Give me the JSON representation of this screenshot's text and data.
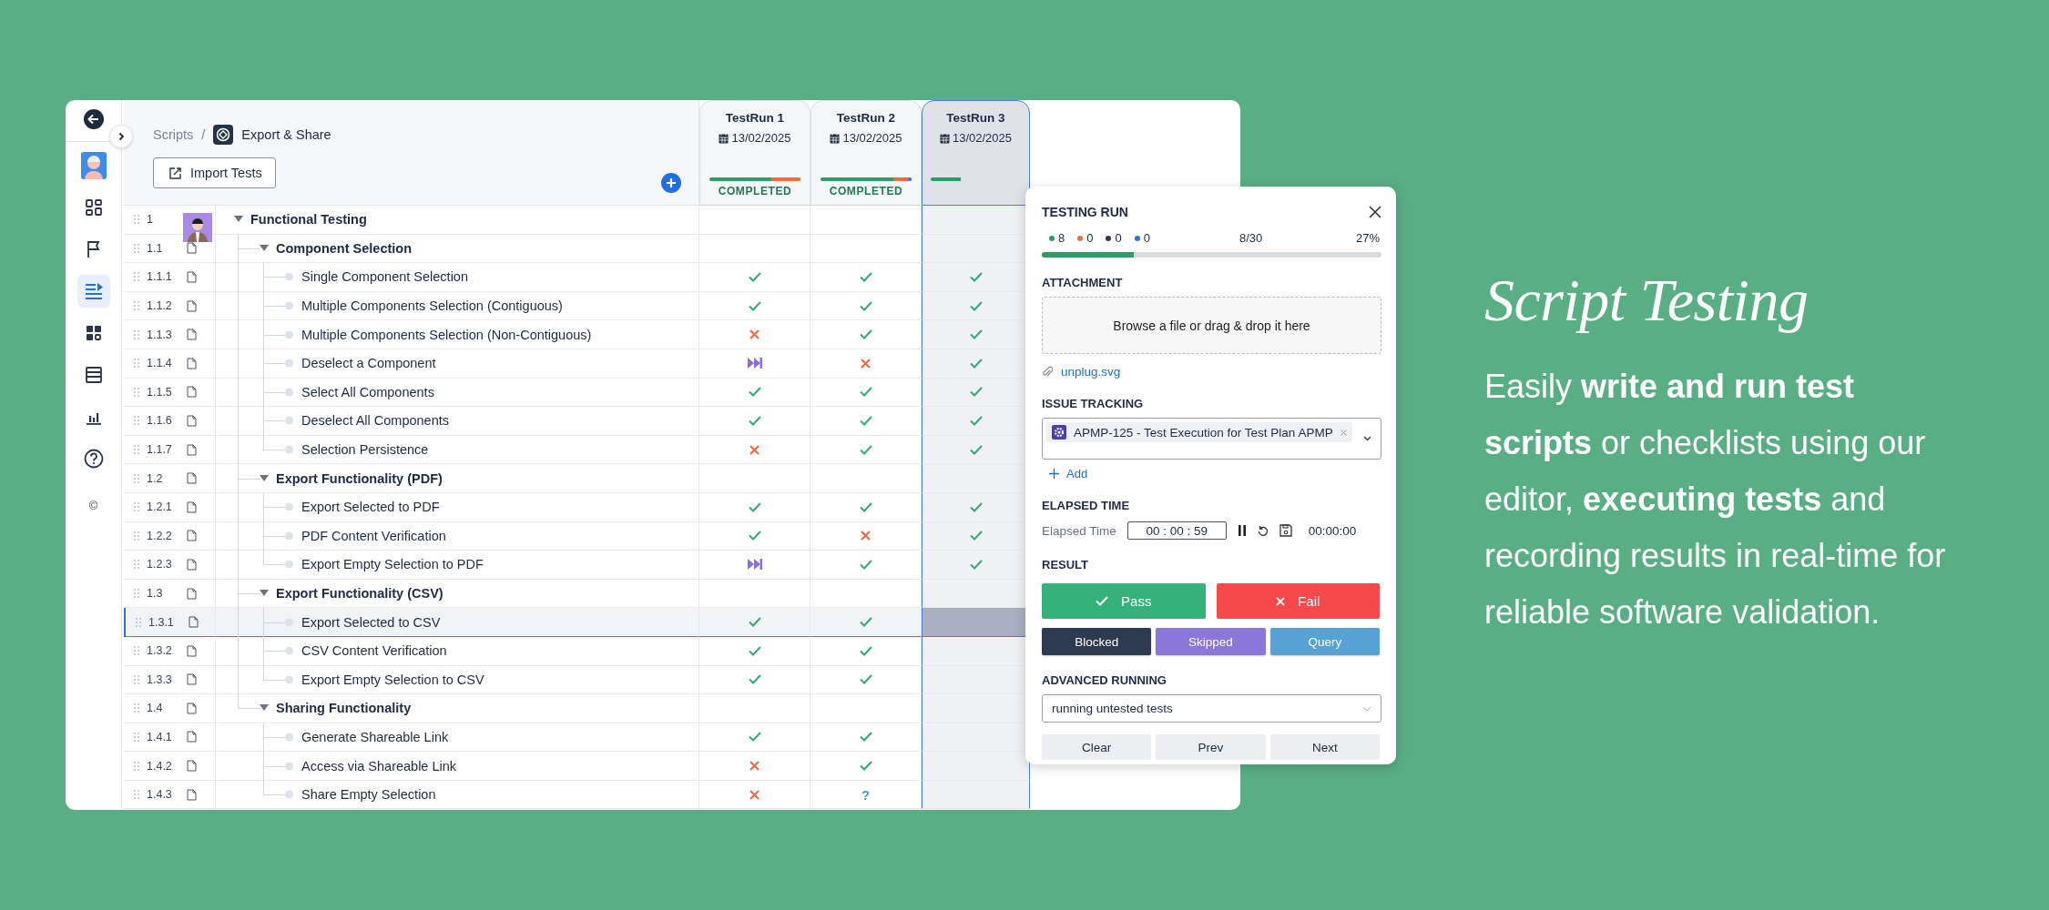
{
  "nav": {
    "items": [
      {
        "kind": "back",
        "selected": false
      },
      {
        "kind": "avatar",
        "selected": false
      },
      {
        "kind": "grid",
        "selected": false
      },
      {
        "kind": "flag",
        "selected": false
      },
      {
        "kind": "list",
        "selected": true
      },
      {
        "kind": "dashboard",
        "selected": false
      },
      {
        "kind": "table",
        "selected": false
      },
      {
        "kind": "chart",
        "selected": false
      },
      {
        "kind": "help",
        "selected": false
      }
    ],
    "footer_mark": "©"
  },
  "breadcrumb": {
    "parent": "Scripts",
    "separator": "/",
    "current": "Export & Share"
  },
  "import_button": "Import Tests",
  "runs": [
    {
      "name": "TestRun 1",
      "date": "13/02/2025",
      "status": "COMPLETED",
      "selected": false,
      "segments": [
        {
          "color": "#2e9b68",
          "level": 0.68
        },
        {
          "color": "#ef6a3c",
          "level": 0.32
        }
      ]
    },
    {
      "name": "TestRun 2",
      "date": "13/02/2025",
      "status": "COMPLETED",
      "selected": false,
      "segments": [
        {
          "color": "#2e9b68",
          "level": 0.8
        },
        {
          "color": "#ef6a3c",
          "level": 0.17
        },
        {
          "color": "#2f6fe0",
          "level": 0.03
        }
      ]
    },
    {
      "name": "TestRun 3",
      "date": "13/02/2025",
      "selected": true,
      "segments": [
        {
          "color": "#2e9b68",
          "level": 0.33
        }
      ]
    }
  ],
  "rows": [
    {
      "number": "1",
      "title": "Functional Testing",
      "kind": "group",
      "avatar": true,
      "selected": false,
      "children": [
        {
          "number": "1.1",
          "title": "Component Selection",
          "kind": "group",
          "selected": false,
          "children": [
            {
              "number": "1.1.1",
              "title": "Single Component Selection",
              "kind": "case",
              "selected": false,
              "results": [
                {
                  "kind": "pass"
                },
                {
                  "kind": "pass"
                },
                {
                  "kind": "pass"
                }
              ]
            },
            {
              "number": "1.1.2",
              "title": "Multiple Components Selection (Contiguous)",
              "kind": "case",
              "selected": false,
              "results": [
                {
                  "kind": "pass"
                },
                {
                  "kind": "pass"
                },
                {
                  "kind": "pass"
                }
              ]
            },
            {
              "number": "1.1.3",
              "title": "Multiple Components Selection (Non-Contiguous)",
              "kind": "case",
              "selected": false,
              "results": [
                {
                  "kind": "fail"
                },
                {
                  "kind": "pass"
                },
                {
                  "kind": "pass"
                }
              ]
            },
            {
              "number": "1.1.4",
              "title": "Deselect a Component",
              "kind": "case",
              "selected": false,
              "results": [
                {
                  "kind": "skipped"
                },
                {
                  "kind": "fail"
                },
                {
                  "kind": "pass"
                }
              ]
            },
            {
              "number": "1.1.5",
              "title": "Select All Components",
              "kind": "case",
              "selected": false,
              "results": [
                {
                  "kind": "pass"
                },
                {
                  "kind": "pass"
                },
                {
                  "kind": "pass"
                }
              ]
            },
            {
              "number": "1.1.6",
              "title": "Deselect All Components",
              "kind": "case",
              "selected": false,
              "results": [
                {
                  "kind": "pass"
                },
                {
                  "kind": "pass"
                },
                {
                  "kind": "pass"
                }
              ]
            },
            {
              "number": "1.1.7",
              "title": "Selection Persistence",
              "kind": "case",
              "selected": false,
              "results": [
                {
                  "kind": "fail"
                },
                {
                  "kind": "pass"
                },
                {
                  "kind": "pass"
                }
              ]
            }
          ]
        },
        {
          "number": "1.2",
          "title": "Export Functionality (PDF)",
          "kind": "group",
          "selected": false,
          "children": [
            {
              "number": "1.2.1",
              "title": "Export Selected to PDF",
              "kind": "case",
              "selected": false,
              "results": [
                {
                  "kind": "pass"
                },
                {
                  "kind": "pass"
                },
                {
                  "kind": "pass"
                }
              ]
            },
            {
              "number": "1.2.2",
              "title": "PDF Content Verification",
              "kind": "case",
              "selected": false,
              "results": [
                {
                  "kind": "pass"
                },
                {
                  "kind": "fail"
                },
                {
                  "kind": "pass"
                }
              ]
            },
            {
              "number": "1.2.3",
              "title": "Export Empty Selection to PDF",
              "kind": "case",
              "selected": false,
              "results": [
                {
                  "kind": "skipped"
                },
                {
                  "kind": "pass"
                },
                {
                  "kind": "pass"
                }
              ]
            }
          ]
        },
        {
          "number": "1.3",
          "title": "Export Functionality (CSV)",
          "kind": "group",
          "selected": false,
          "children": [
            {
              "number": "1.3.1",
              "title": "Export Selected to CSV",
              "kind": "case",
              "selected": true,
              "results": [
                {
                  "kind": "pass"
                },
                {
                  "kind": "pass"
                }
              ]
            },
            {
              "number": "1.3.2",
              "title": "CSV Content Verification",
              "kind": "case",
              "selected": false,
              "results": [
                {
                  "kind": "pass"
                },
                {
                  "kind": "pass"
                }
              ]
            },
            {
              "number": "1.3.3",
              "title": "Export Empty Selection to CSV",
              "kind": "case",
              "selected": false,
              "results": [
                {
                  "kind": "pass"
                },
                {
                  "kind": "pass"
                }
              ]
            }
          ]
        },
        {
          "number": "1.4",
          "title": "Sharing Functionality",
          "kind": "group",
          "selected": false,
          "children": [
            {
              "number": "1.4.1",
              "title": "Generate Shareable Link",
              "kind": "case",
              "selected": false,
              "results": [
                {
                  "kind": "pass"
                },
                {
                  "kind": "pass"
                }
              ]
            },
            {
              "number": "1.4.2",
              "title": "Access via Shareable Link",
              "kind": "case",
              "selected": false,
              "results": [
                {
                  "kind": "fail"
                },
                {
                  "kind": "pass"
                }
              ]
            },
            {
              "number": "1.4.3",
              "title": "Share Empty Selection",
              "kind": "case",
              "selected": false,
              "results": [
                {
                  "kind": "fail"
                },
                {
                  "kind": "query",
                  "text": "?"
                }
              ]
            }
          ]
        }
      ]
    }
  ],
  "panel": {
    "title": "TESTING RUN",
    "counts": [
      {
        "color": "#2e9b68",
        "count": "8"
      },
      {
        "color": "#ef6a3c",
        "count": "0"
      },
      {
        "color": "#2e3a4f",
        "count": "0"
      },
      {
        "color": "#2f6fe0",
        "count": "0"
      }
    ],
    "progress": {
      "done": "8/30",
      "percent": "27%",
      "level": 0.27
    },
    "attachment": {
      "label": "ATTACHMENT",
      "dropzone": "Browse a file or drag & drop it here",
      "file": "unplug.svg"
    },
    "issues": {
      "label": "ISSUE TRACKING",
      "chip": "APMP-125 - Test Execution for Test Plan APMP",
      "add": "Add"
    },
    "elapsed": {
      "label": "ELAPSED TIME",
      "field_label": "Elapsed Time",
      "value": "00 : 00 : 59",
      "total": "00:00:00"
    },
    "result": {
      "label": "RESULT",
      "buttons": [
        {
          "kind": "pass",
          "label": "Pass"
        },
        {
          "kind": "fail",
          "label": "Fail"
        },
        {
          "kind": "blocked",
          "label": "Blocked"
        },
        {
          "kind": "skipped",
          "label": "Skipped"
        },
        {
          "kind": "query",
          "label": "Query"
        }
      ]
    },
    "advanced": {
      "label": "ADVANCED RUNNING",
      "value": "running untested tests"
    },
    "footer_buttons": [
      "Clear",
      "Prev",
      "Next"
    ]
  },
  "promo": {
    "title": "Script Testing",
    "text": "Easily **write and run test scripts** or checklists using our editor, **executing tests** and recording results in real-time for reliable software validation."
  }
}
